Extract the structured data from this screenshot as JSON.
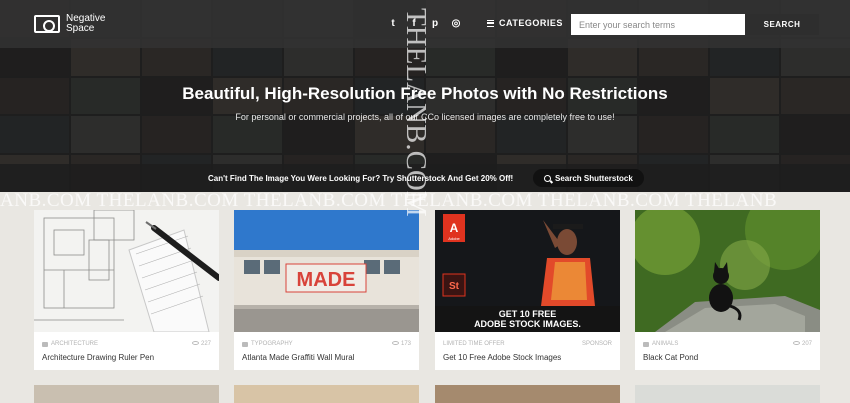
{
  "brand": {
    "name_line1": "Negative",
    "name_line2": "Space"
  },
  "socials": [
    {
      "icon": "twitter-icon",
      "glyph": "t"
    },
    {
      "icon": "facebook-icon",
      "glyph": "f"
    },
    {
      "icon": "pinterest-icon",
      "glyph": "p"
    },
    {
      "icon": "instagram-icon",
      "glyph": "◎"
    }
  ],
  "nav": {
    "categories_label": "CATEGORIES"
  },
  "search": {
    "placeholder": "Enter your search terms",
    "button_label": "SEARCH"
  },
  "hero": {
    "title": "Beautiful, High-Resolution Free Photos with No Restrictions",
    "subtitle": "For personal or commercial projects, all of our CCo licensed images are completely free to use!"
  },
  "promo": {
    "text": "Can't Find The Image You Were Looking For? Try Shutterstock And Get 20% Off!",
    "button_label": "Search Shutterstock"
  },
  "cards": [
    {
      "category": "ARCHITECTURE",
      "views": "227",
      "title": "Architecture Drawing Ruler Pen"
    },
    {
      "category": "TYPOGRAPHY",
      "views": "173",
      "title": "Atlanta Made Graffiti Wall Mural",
      "sign_text": "MADE"
    },
    {
      "category": "LIMITED TIME OFFER",
      "tag": "SPONSOR",
      "title": "Get 10 Free Adobe Stock Images",
      "banner_line1": "GET 10 FREE",
      "banner_line2": "ADOBE STOCK IMAGES.",
      "adobe_label": "Adobe",
      "st_label": "St"
    },
    {
      "category": "ANIMALS",
      "views": "207",
      "title": "Black Cat Pond"
    }
  ],
  "watermark": {
    "horizontal": "ANB.COM THELANB.COM THELANB.COM THELANB.COM THELANB.COM THELANB",
    "vertical": "THELANB.COM"
  },
  "colors": {
    "hero_dark": "#2b2b2b",
    "page_bg": "#e9e7e2",
    "adobe_red": "#e0331f"
  }
}
